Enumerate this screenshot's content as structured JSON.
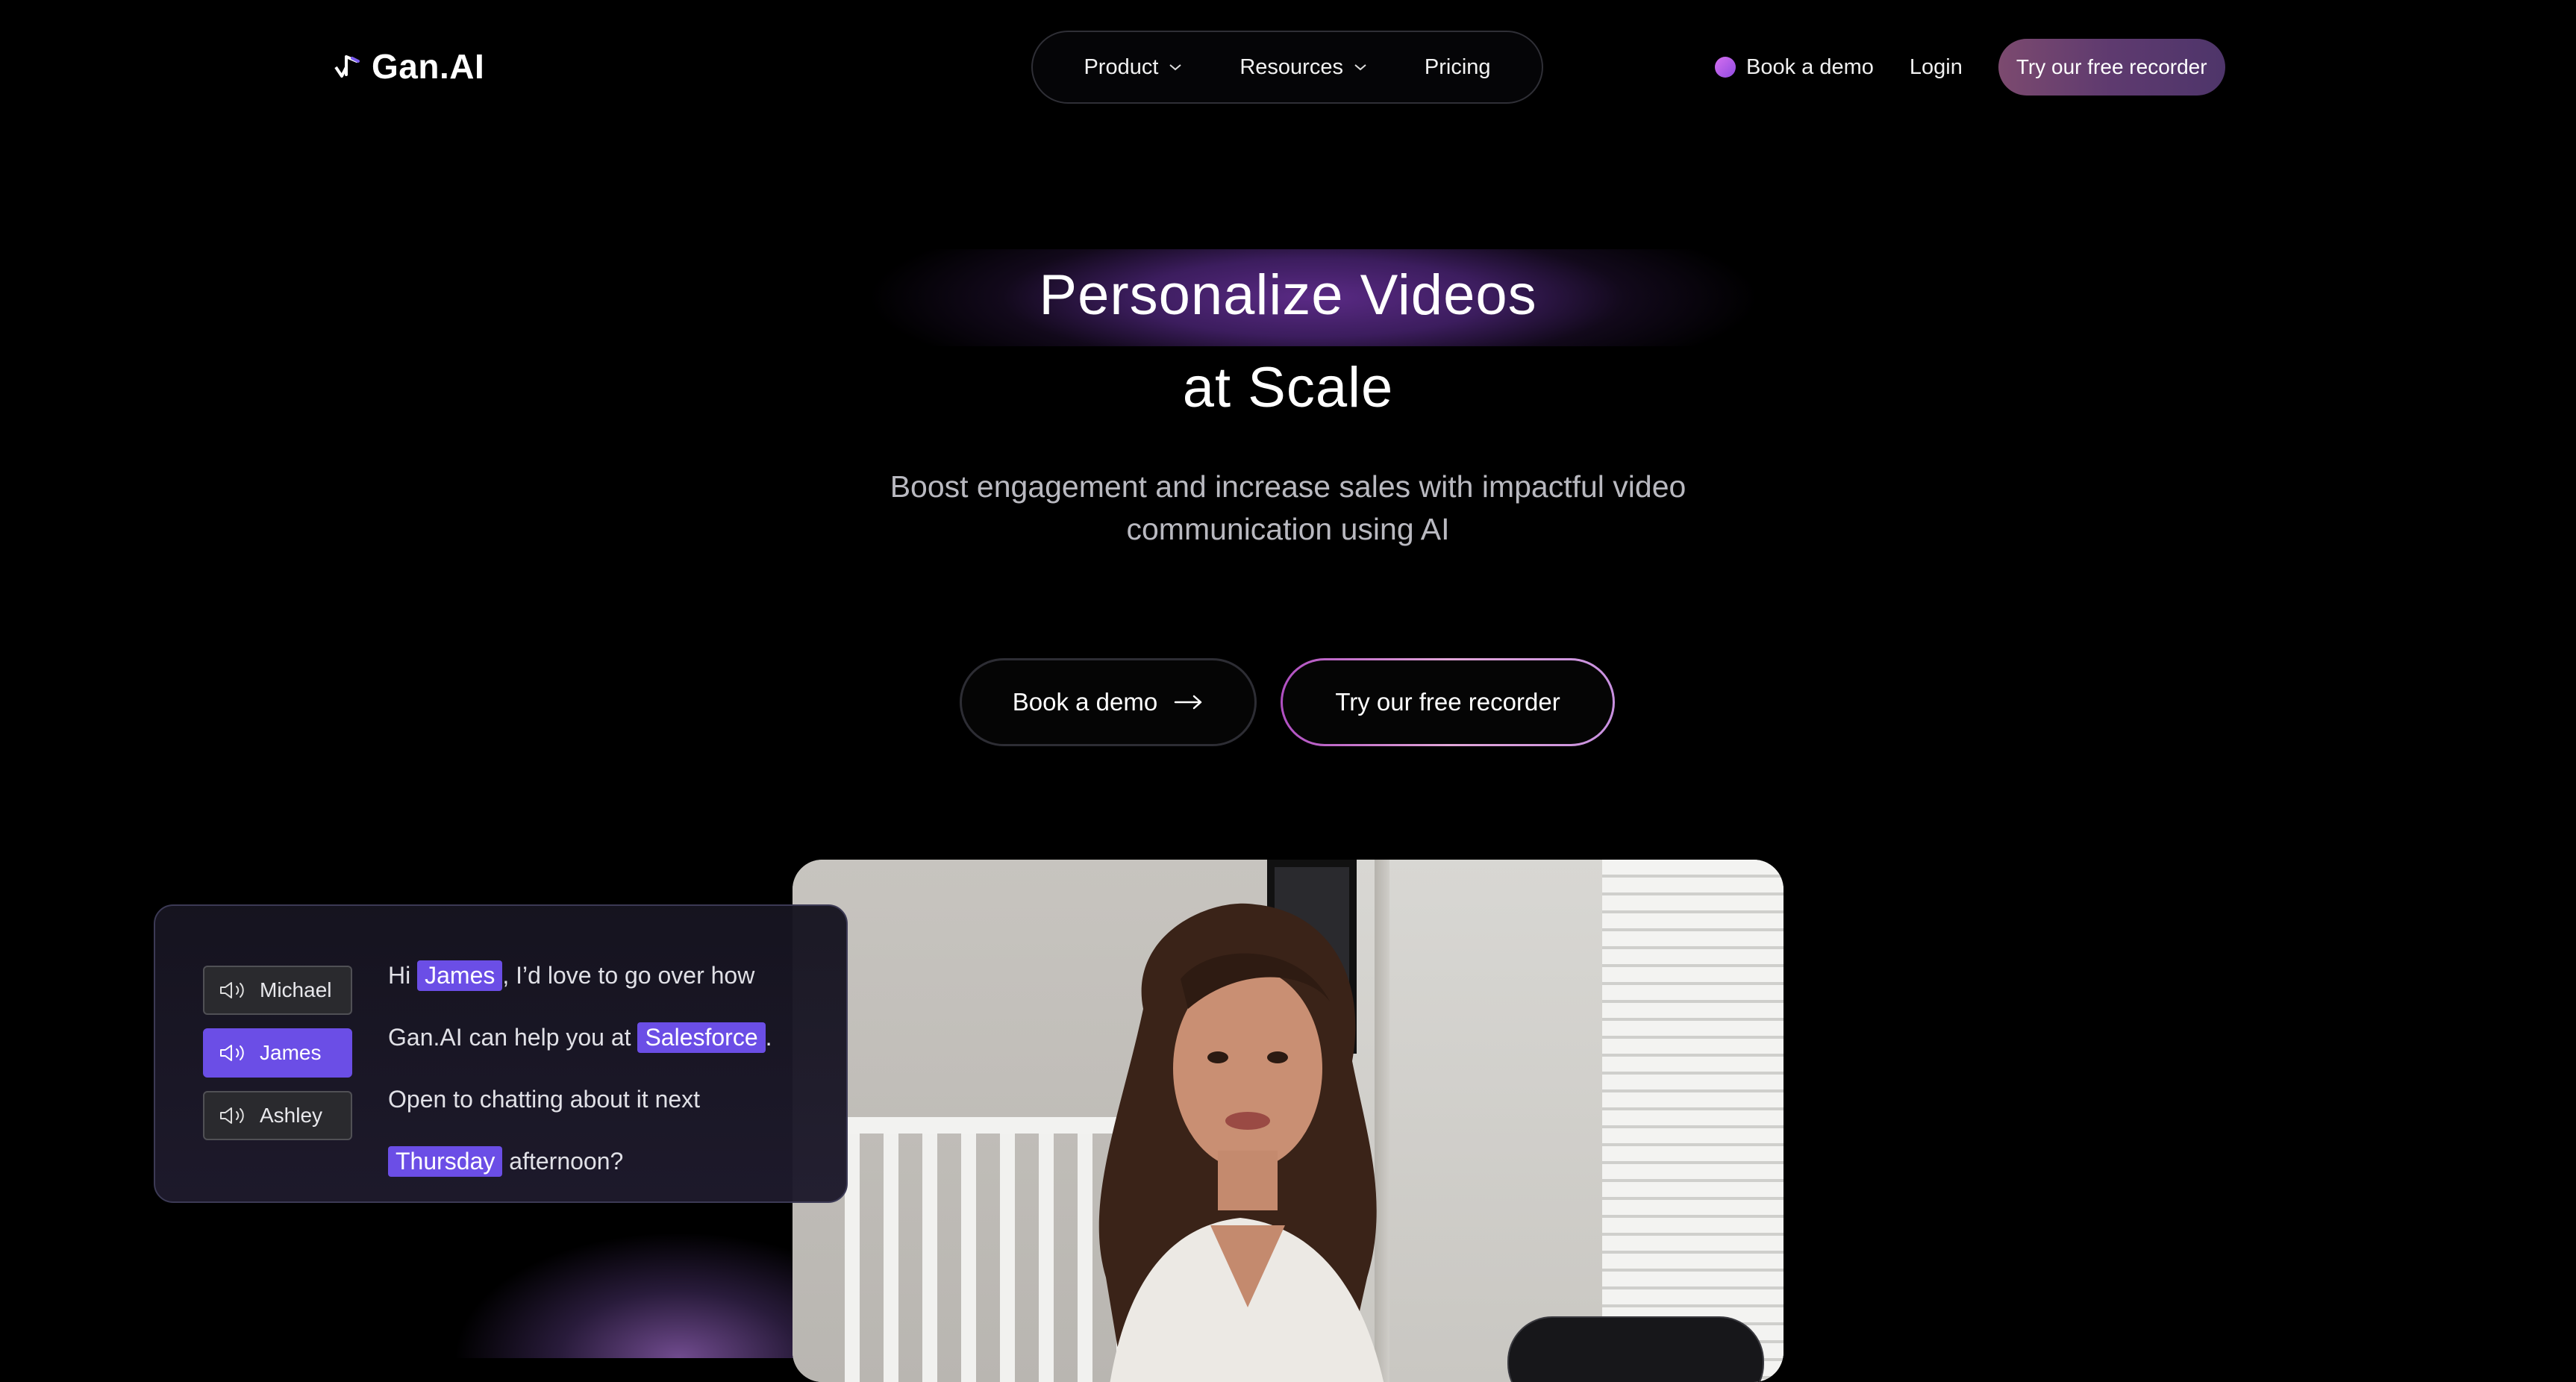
{
  "brand": {
    "name": "Gan.AI"
  },
  "nav": {
    "items": [
      {
        "label": "Product",
        "has_dropdown": true
      },
      {
        "label": "Resources",
        "has_dropdown": true
      },
      {
        "label": "Pricing",
        "has_dropdown": false
      }
    ],
    "book_demo": "Book a demo",
    "login": "Login",
    "try_recorder": "Try our free recorder"
  },
  "hero": {
    "title_line1": "Personalize Videos",
    "title_line2": "at Scale",
    "subtitle": "Boost engagement and increase sales with impactful video communication using AI",
    "cta_demo": "Book a demo",
    "cta_recorder": "Try our free recorder"
  },
  "personalization": {
    "names": [
      {
        "label": "Michael",
        "active": false
      },
      {
        "label": "James",
        "active": true
      },
      {
        "label": "Ashley",
        "active": false
      }
    ],
    "script": {
      "l1_pre": "Hi",
      "l1_name": "James",
      "l1_post": ", I’d love to go over how",
      "l2_pre": "Gan.AI can help you at",
      "l2_company": "Salesforce",
      "l2_post": ".",
      "l3": "Open to chatting about it next",
      "l4_day": "Thursday",
      "l4_post": "afternoon?"
    }
  },
  "colors": {
    "accent_purple": "#6b4ee6",
    "button_gradient": "#7c4a6f"
  }
}
